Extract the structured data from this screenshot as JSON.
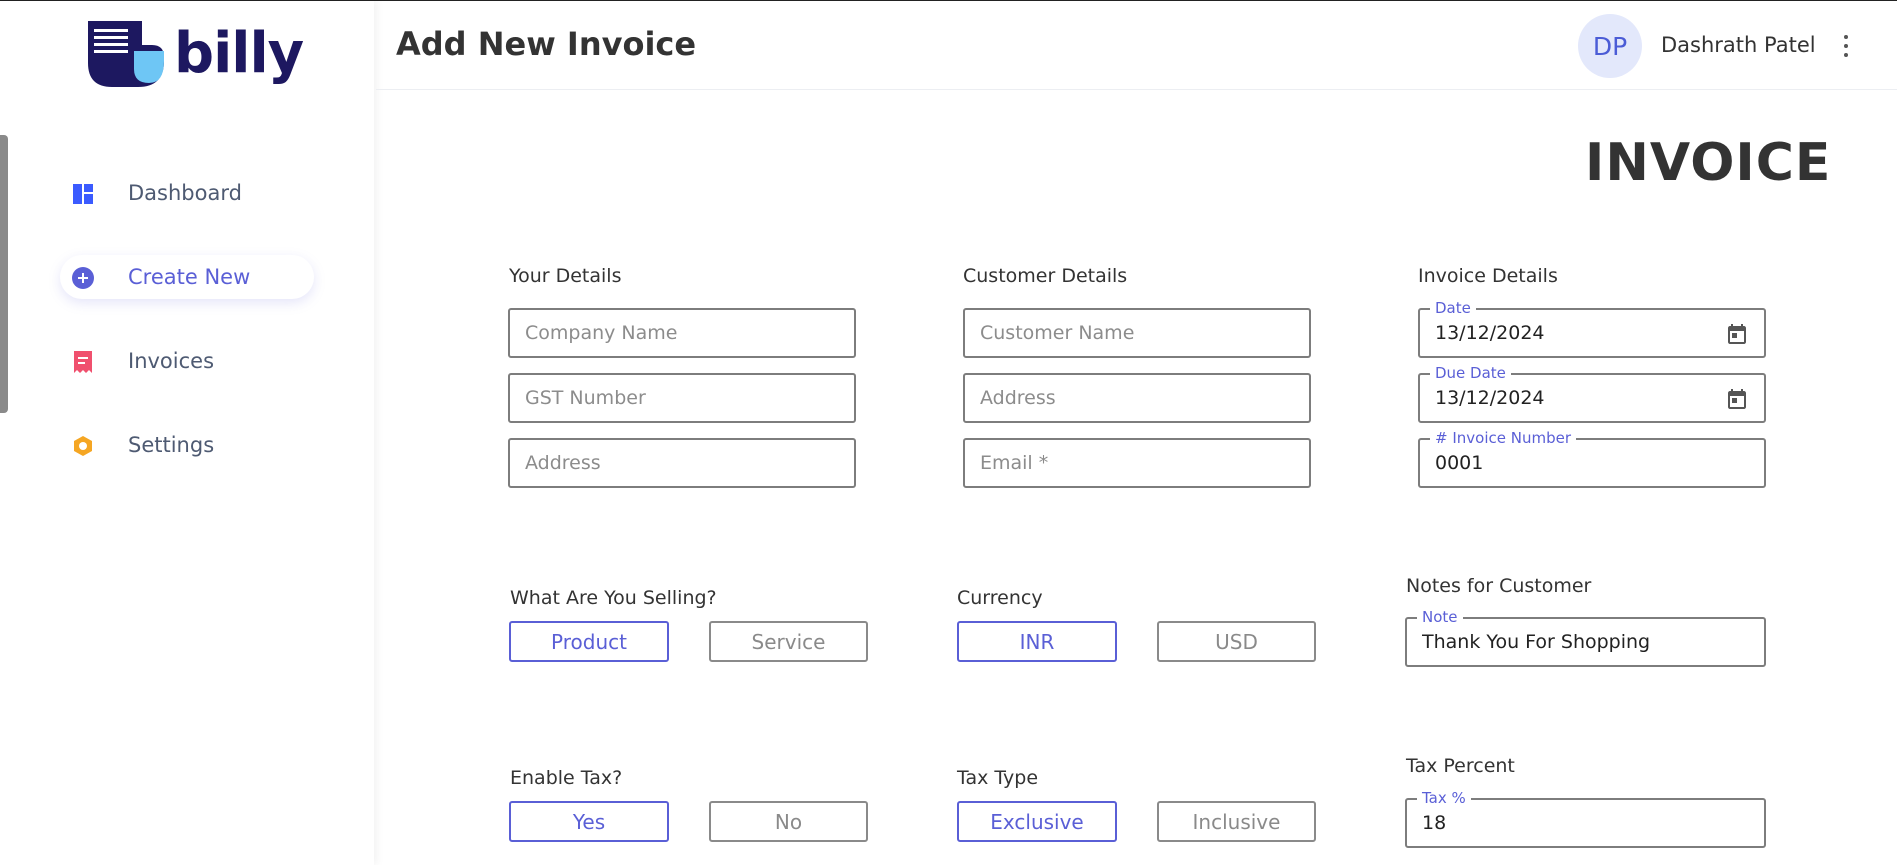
{
  "app": {
    "logo_text": "billy",
    "page_title": "Add New Invoice",
    "user_initials": "DP",
    "user_name": "Dashrath Patel"
  },
  "sidebar": {
    "items": [
      {
        "label": "Dashboard",
        "icon": "dashboard-icon",
        "color": "#3b5bff",
        "active": false
      },
      {
        "label": "Create New",
        "icon": "plus-circle-icon",
        "color": "#5a5fd6",
        "active": true
      },
      {
        "label": "Invoices",
        "icon": "receipt-icon",
        "color": "#f0506e",
        "active": false
      },
      {
        "label": "Settings",
        "icon": "settings-icon",
        "color": "#f5a623",
        "active": false
      }
    ]
  },
  "invoice": {
    "heading": "INVOICE",
    "your_details": {
      "label": "Your Details",
      "company_placeholder": "Company Name",
      "gst_placeholder": "GST Number",
      "address_placeholder": "Address"
    },
    "customer_details": {
      "label": "Customer Details",
      "name_placeholder": "Customer Name",
      "address_placeholder": "Address",
      "email_placeholder": "Email *"
    },
    "invoice_details": {
      "label": "Invoice Details",
      "date_label": "Date",
      "date_value": "13/12/2024",
      "due_label": "Due Date",
      "due_value": "13/12/2024",
      "number_label": "# Invoice Number",
      "number_value": "0001"
    },
    "selling": {
      "label": "What Are You Selling?",
      "options": [
        "Product",
        "Service"
      ],
      "selected": "Product"
    },
    "currency": {
      "label": "Currency",
      "options": [
        "INR",
        "USD"
      ],
      "selected": "INR"
    },
    "notes": {
      "label": "Notes for Customer",
      "field_label": "Note",
      "value": "Thank You For Shopping"
    },
    "enable_tax": {
      "label": "Enable Tax?",
      "options": [
        "Yes",
        "No"
      ],
      "selected": "Yes"
    },
    "tax_type": {
      "label": "Tax Type",
      "options": [
        "Exclusive",
        "Inclusive"
      ],
      "selected": "Exclusive"
    },
    "tax_percent": {
      "label": "Tax Percent",
      "field_label": "Tax %",
      "value": "18"
    }
  },
  "colors": {
    "accent": "#5a5fd6",
    "logo_dark": "#1d1860",
    "logo_light": "#6ec6f5",
    "field_border": "#7d7d7d"
  }
}
